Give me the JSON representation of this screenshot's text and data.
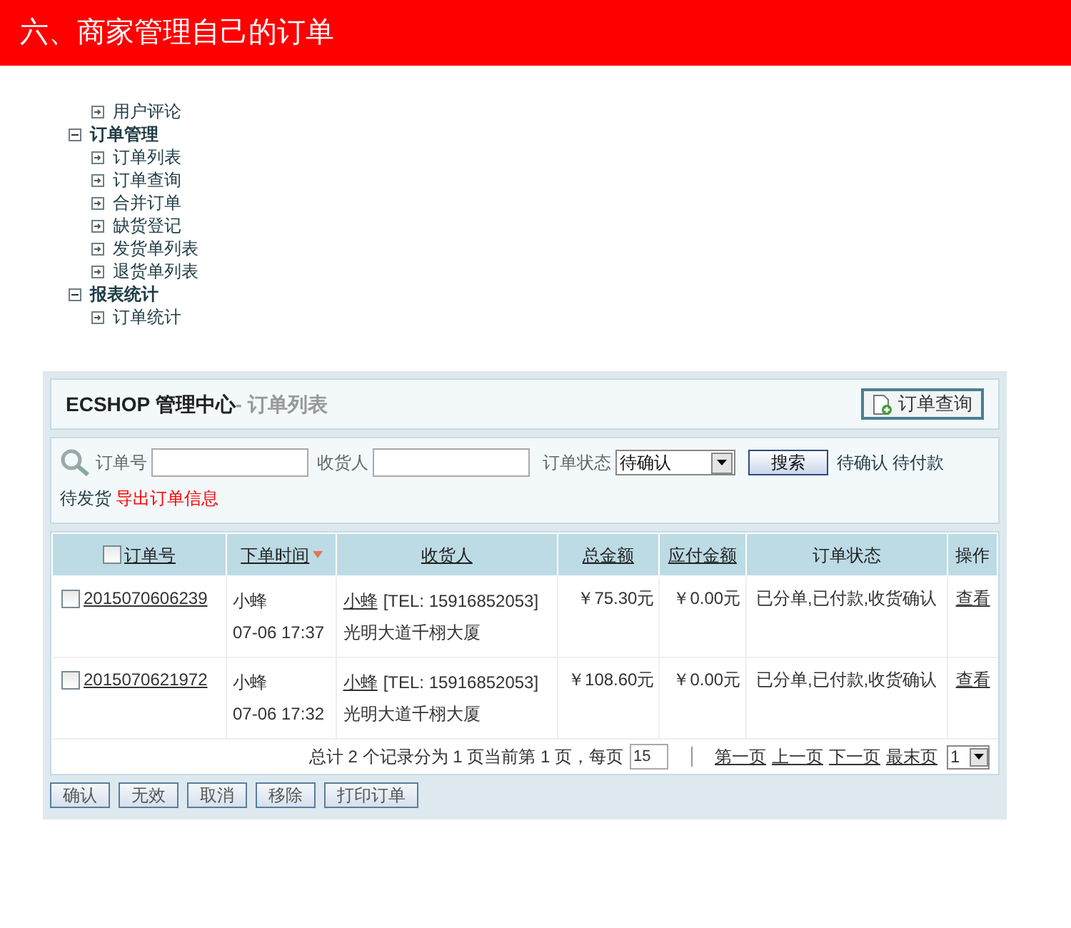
{
  "header": {
    "title": "六、商家管理自己的订单"
  },
  "menu": [
    {
      "label": "用户评论",
      "kind": "leaf"
    },
    {
      "label": "订单管理",
      "kind": "group",
      "expanded": true,
      "children": [
        {
          "label": "订单列表",
          "kind": "leaf"
        },
        {
          "label": "订单查询",
          "kind": "leaf"
        },
        {
          "label": "合并订单",
          "kind": "leaf"
        },
        {
          "label": "缺货登记",
          "kind": "leaf"
        },
        {
          "label": "发货单列表",
          "kind": "leaf"
        },
        {
          "label": "退货单列表",
          "kind": "leaf"
        }
      ]
    },
    {
      "label": "报表统计",
      "kind": "group",
      "expanded": true,
      "children": [
        {
          "label": "订单统计",
          "kind": "leaf"
        }
      ]
    }
  ],
  "panel": {
    "brand": "ECSHOP 管理中心",
    "subtitle": "- 订单列表",
    "action": "订单查询"
  },
  "search": {
    "fields": [
      {
        "label": "订单号"
      },
      {
        "label": "收货人"
      }
    ],
    "status_label": "订单状态",
    "status_value": "待确认",
    "button": "搜索",
    "quick_links": [
      "待确认",
      "待付款",
      "待发货"
    ],
    "export": "导出订单信息"
  },
  "table": {
    "select_all_checked": false,
    "columns": [
      {
        "label": "订单号",
        "link": true,
        "sorted": false,
        "checkbox": true
      },
      {
        "label": "下单时间",
        "link": true,
        "sorted": true,
        "checkbox": false
      },
      {
        "label": "收货人",
        "link": true,
        "sorted": false,
        "checkbox": false
      },
      {
        "label": "总金额",
        "link": true,
        "sorted": false,
        "checkbox": false
      },
      {
        "label": "应付金额",
        "link": true,
        "sorted": false,
        "checkbox": false
      },
      {
        "label": "订单状态",
        "link": false,
        "sorted": false,
        "checkbox": false
      },
      {
        "label": "操作",
        "link": false,
        "sorted": false,
        "checkbox": false
      }
    ],
    "rows": [
      {
        "checked": false,
        "order_no": "2015070606239",
        "buyer": "小蜂",
        "time": "07-06 17:37",
        "consignee": "小蜂",
        "tel": "[TEL: 15916852053]",
        "address": "光明大道千栩大厦",
        "total": "￥75.30元",
        "payable": "￥0.00元",
        "status": "已分单,已付款,收货确认",
        "action": "查看"
      },
      {
        "checked": false,
        "order_no": "2015070621972",
        "buyer": "小蜂",
        "time": "07-06 17:32",
        "consignee": "小蜂",
        "tel": "[TEL: 15916852053]",
        "address": "光明大道千栩大厦",
        "total": "￥108.60元",
        "payable": "￥0.00元",
        "status": "已分单,已付款,收货确认",
        "action": "查看"
      }
    ]
  },
  "pagination": {
    "summary": "总计 2 个记录分为 1 页当前第 1 页，每页",
    "page_size": "15",
    "links": [
      "第一页",
      "上一页",
      "下一页",
      "最末页"
    ],
    "page": "1"
  },
  "actions": [
    "确认",
    "无效",
    "取消",
    "移除",
    "打印订单"
  ]
}
